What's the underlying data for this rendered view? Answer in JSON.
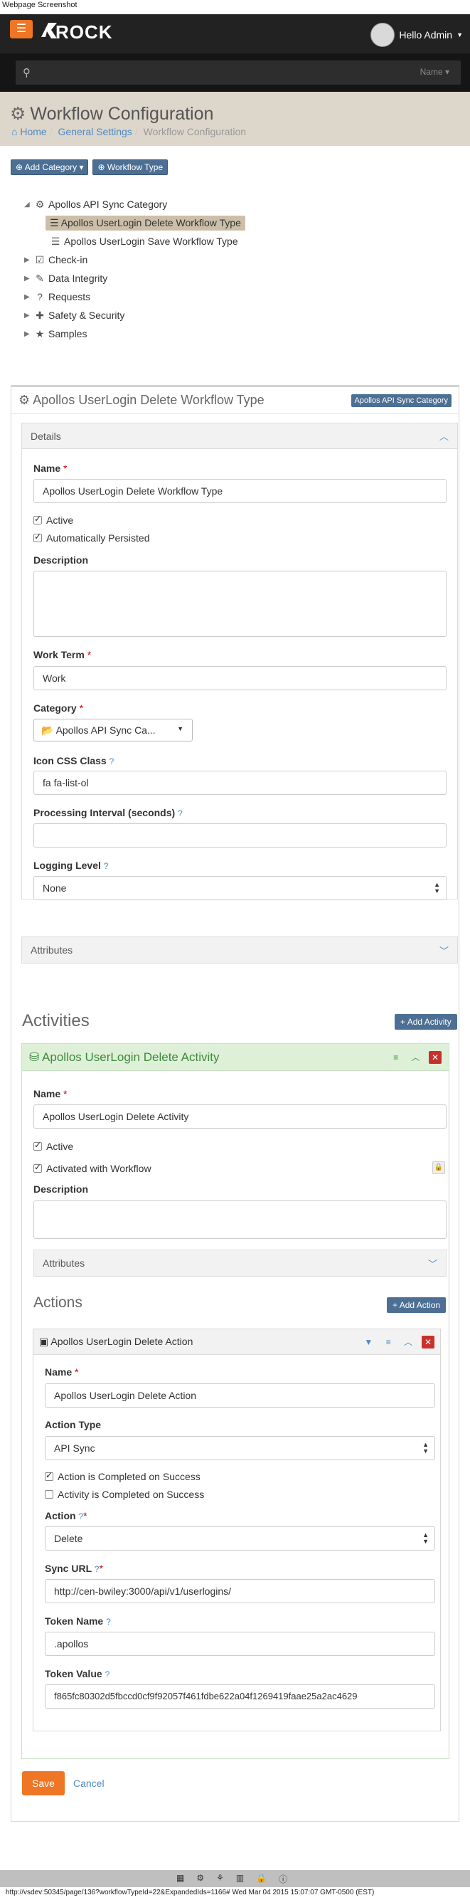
{
  "screenshot_caption": "Webpage Screenshot",
  "navbar": {
    "menu_icon": "hamburger-icon",
    "logo_text": "ROCK",
    "greeting": "Hello Admin",
    "search_type": "Name"
  },
  "page": {
    "title": "Workflow Configuration",
    "breadcrumb": {
      "home": "Home",
      "general_settings": "General Settings",
      "current": "Workflow Configuration"
    }
  },
  "toolbar": {
    "add_category": "Add Category",
    "workflow_type": "Workflow Type"
  },
  "tree": {
    "category": "Apollos API Sync Category",
    "items": [
      "Apollos UserLogin Delete Workflow Type",
      "Apollos UserLogin Save Workflow Type"
    ],
    "other_categories": [
      "Check-in",
      "Data Integrity",
      "Requests",
      "Safety & Security",
      "Samples"
    ]
  },
  "workflow_panel": {
    "title": "Apollos UserLogin Delete Workflow Type",
    "category_label": "Apollos API Sync Category",
    "details_title": "Details",
    "name_label": "Name",
    "name_value": "Apollos UserLogin Delete Workflow Type",
    "active_label": "Active",
    "auto_persisted_label": "Automatically Persisted",
    "description_label": "Description",
    "work_term_label": "Work Term",
    "work_term_value": "Work",
    "category_field_label": "Category",
    "category_value": "Apollos API Sync Ca...",
    "icon_css_label": "Icon CSS Class",
    "icon_css_value": "fa fa-list-ol",
    "processing_label": "Processing Interval (seconds)",
    "processing_value": "",
    "logging_label": "Logging Level",
    "logging_value": "None",
    "attributes_title": "Attributes"
  },
  "activities": {
    "title": "Activities",
    "add_button": "Add Activity",
    "activity": {
      "title": "Apollos UserLogin Delete Activity",
      "name_label": "Name",
      "name_value": "Apollos UserLogin Delete Activity",
      "active_label": "Active",
      "activated_label": "Activated with Workflow",
      "description_label": "Description",
      "attributes_title": "Attributes",
      "actions_title": "Actions",
      "add_action": "Add Action"
    }
  },
  "action": {
    "title": "Apollos UserLogin Delete Action",
    "name_label": "Name",
    "name_value": "Apollos UserLogin Delete Action",
    "type_label": "Action Type",
    "type_value": "API Sync",
    "completed_label": "Action is Completed on Success",
    "activity_completed_label": "Activity is Completed on Success",
    "action_label": "Action",
    "action_value": "Delete",
    "sync_url_label": "Sync URL",
    "sync_url_value": "http://cen-bwiley:3000/api/v1/userlogins/",
    "token_name_label": "Token Name",
    "token_name_value": ".apollos",
    "token_value_label": "Token Value",
    "token_value_value": "f865fc80302d5fbccd0cf9f92057f461fdbe622a04f1269419faae25a2ac4629"
  },
  "buttons": {
    "save": "Save",
    "cancel": "Cancel"
  },
  "status_line": "http://vsdev:50345/page/136?workflowTypeId=22&ExpandedIds=1166# Wed Mar 04 2015 15:07:07 GMT-0500 (EST)",
  "colors": {
    "accent_orange": "#ee7624",
    "primary_blue": "#4c6f93",
    "link_blue": "#4f8ac4",
    "header_beige": "#ddd6cb",
    "activity_green": "#dff0d8"
  }
}
